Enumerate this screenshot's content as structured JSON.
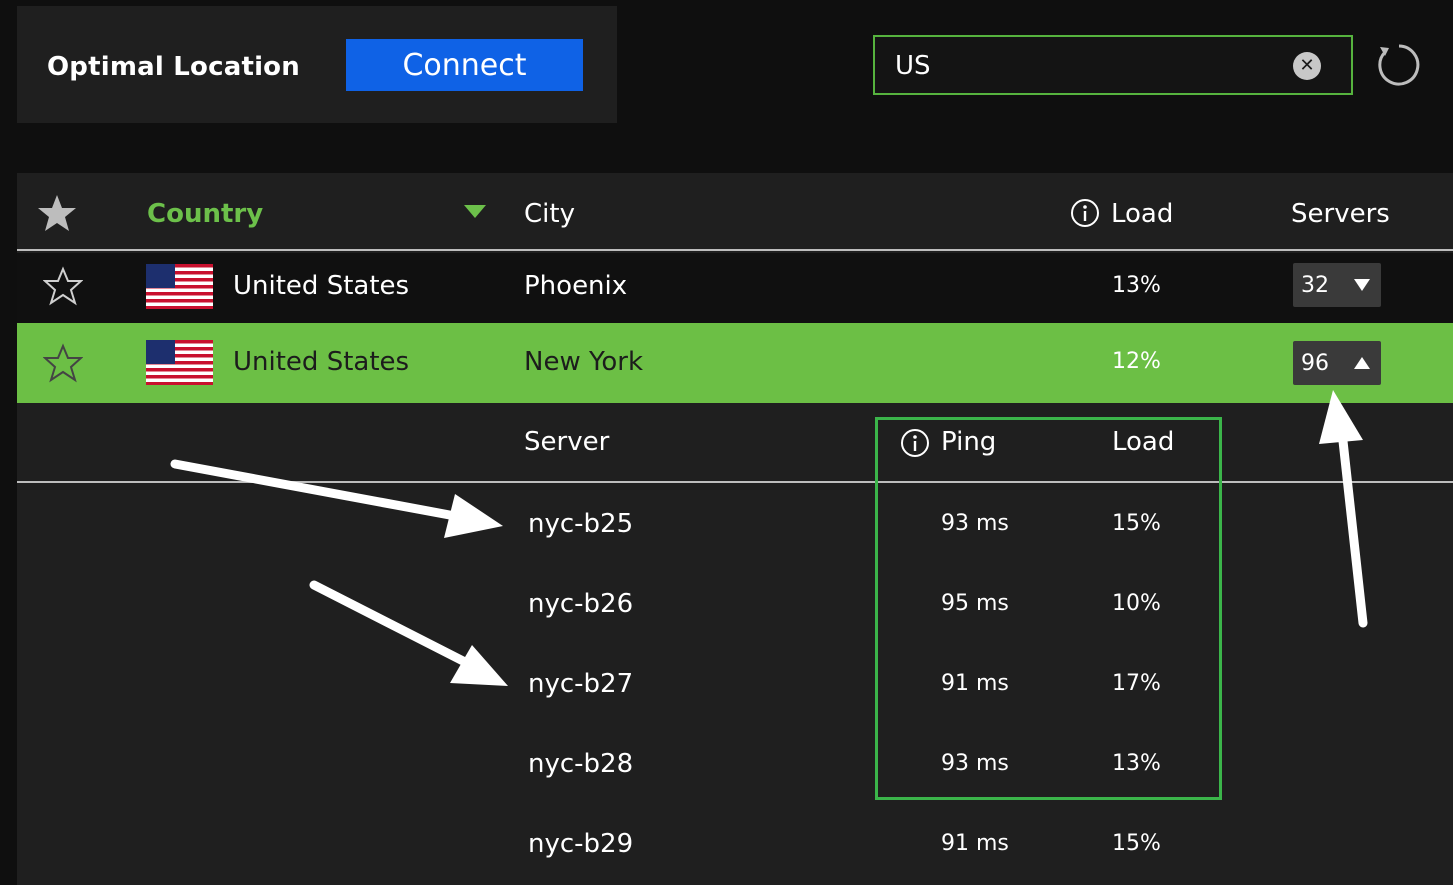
{
  "top": {
    "optimal_label": "Optimal Location",
    "connect_label": "Connect",
    "search_value": "US"
  },
  "table": {
    "headers": {
      "country": "Country",
      "city": "City",
      "load": "Load",
      "servers": "Servers"
    },
    "rows": [
      {
        "country": "United States",
        "city": "Phoenix",
        "load": "13%",
        "servers": "32",
        "expanded": false
      },
      {
        "country": "United States",
        "city": "New York",
        "load": "12%",
        "servers": "96",
        "expanded": true
      }
    ],
    "sub_headers": {
      "server": "Server",
      "ping": "Ping",
      "load": "Load"
    },
    "servers": [
      {
        "name": "nyc-b25",
        "ping": "93 ms",
        "load": "15%"
      },
      {
        "name": "nyc-b26",
        "ping": "95 ms",
        "load": "10%"
      },
      {
        "name": "nyc-b27",
        "ping": "91 ms",
        "load": "17%"
      },
      {
        "name": "nyc-b28",
        "ping": "93 ms",
        "load": "13%"
      },
      {
        "name": "nyc-b29",
        "ping": "91 ms",
        "load": "15%"
      }
    ]
  },
  "colors": {
    "accent_green": "#6cbf45",
    "connect_blue": "#0f62e6",
    "highlight_box": "#3bb54a"
  }
}
